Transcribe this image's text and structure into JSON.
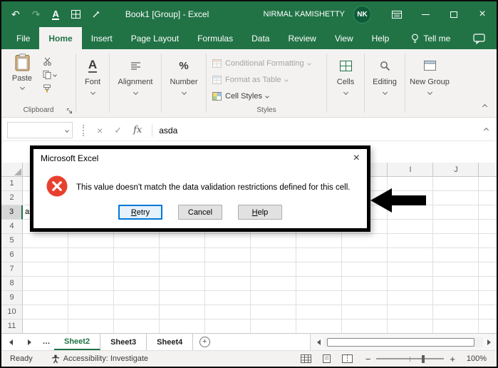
{
  "colors": {
    "excel_green": "#217346",
    "error_red": "#e8402f",
    "focus_blue": "#0078d7"
  },
  "icons": {
    "undo": "↶",
    "redo": "↷",
    "underline_a": "A",
    "font_a": "A",
    "percent": "%",
    "close": "×",
    "check": "✓",
    "fx": "fx",
    "minus": "−",
    "plus": "+",
    "more_sheets": "…",
    "add_sheet": "+"
  },
  "titlebar": {
    "title": "Book1  [Group] - Excel",
    "user_name": "NIRMAL KAMISHETTY",
    "avatar_initials": "NK"
  },
  "ribbon": {
    "tabs": [
      {
        "label": "File",
        "active": false
      },
      {
        "label": "Home",
        "active": true
      },
      {
        "label": "Insert",
        "active": false
      },
      {
        "label": "Page Layout",
        "active": false
      },
      {
        "label": "Formulas",
        "active": false
      },
      {
        "label": "Data",
        "active": false
      },
      {
        "label": "Review",
        "active": false
      },
      {
        "label": "View",
        "active": false
      },
      {
        "label": "Help",
        "active": false
      }
    ],
    "tell_me_label": "Tell me",
    "clipboard_group": {
      "label": "Clipboard",
      "paste_label": "Paste"
    },
    "font_group": {
      "label": "Font"
    },
    "alignment_group": {
      "label": "Alignment"
    },
    "number_group": {
      "label": "Number"
    },
    "styles_group": {
      "label": "Styles",
      "conditional_formatting_label": "Conditional Formatting",
      "format_as_table_label": "Format as Table",
      "cell_styles_label": "Cell Styles"
    },
    "cells_group": {
      "label": "Cells"
    },
    "editing_group": {
      "label": "Editing"
    },
    "new_group": {
      "label": "New Group"
    }
  },
  "formula_bar": {
    "name_box_value": "",
    "value": "asda"
  },
  "dialog": {
    "title": "Microsoft Excel",
    "message": "This value doesn't match the data validation restrictions defined for this cell.",
    "buttons": {
      "retry": "Retry",
      "cancel": "Cancel",
      "help": "Help"
    }
  },
  "sheet": {
    "visible_column_headers": [
      "I",
      "J"
    ],
    "row_headers": [
      "1",
      "2",
      "3",
      "4",
      "5",
      "6",
      "7",
      "8",
      "9",
      "10",
      "11"
    ],
    "selected_row": "3",
    "active_cell_value": "asda"
  },
  "sheet_tabs": [
    {
      "label": "Sheet2",
      "active": true
    },
    {
      "label": "Sheet3",
      "active": false
    },
    {
      "label": "Sheet4",
      "active": false
    }
  ],
  "status_bar": {
    "ready_label": "Ready",
    "accessibility_label": "Accessibility: Investigate",
    "zoom_level": "100%"
  }
}
